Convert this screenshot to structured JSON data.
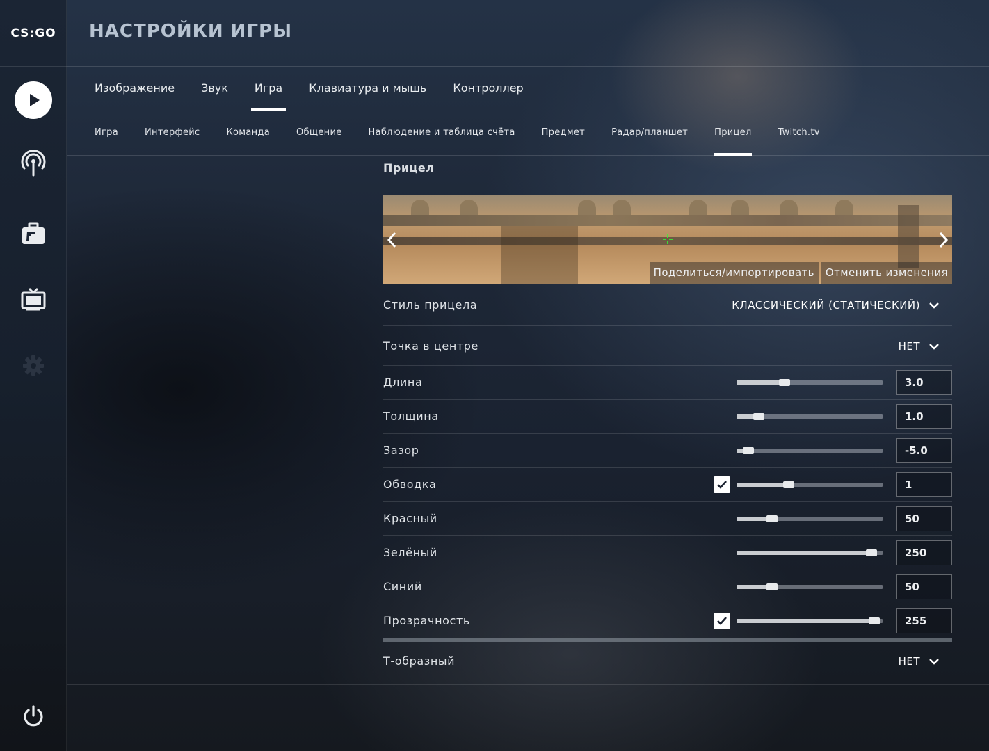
{
  "app": {
    "logo_text": "CS:GO"
  },
  "header": {
    "title": "НАСТРОЙКИ ИГРЫ"
  },
  "sidebar": {
    "items": [
      {
        "icon": "play-icon"
      },
      {
        "icon": "broadcast-icon"
      },
      {
        "icon": "inventory-icon"
      },
      {
        "icon": "tv-icon"
      },
      {
        "icon": "gear-icon"
      },
      {
        "icon": "power-icon"
      }
    ]
  },
  "main_tabs": [
    {
      "label": "Изображение",
      "active": false
    },
    {
      "label": "Звук",
      "active": false
    },
    {
      "label": "Игра",
      "active": true
    },
    {
      "label": "Клавиатура и мышь",
      "active": false
    },
    {
      "label": "Контроллер",
      "active": false
    }
  ],
  "sub_tabs": [
    {
      "label": "Игра",
      "active": false
    },
    {
      "label": "Интерфейс",
      "active": false
    },
    {
      "label": "Команда",
      "active": false
    },
    {
      "label": "Общение",
      "active": false
    },
    {
      "label": "Наблюдение и таблица счёта",
      "active": false
    },
    {
      "label": "Предмет",
      "active": false
    },
    {
      "label": "Радар/планшет",
      "active": false
    },
    {
      "label": "Прицел",
      "active": true
    },
    {
      "label": "Twitch.tv",
      "active": false
    }
  ],
  "section": {
    "title": "Прицел",
    "preview": {
      "share_label": "Поделиться/импортировать",
      "revert_label": "Отменить изменения",
      "crosshair_color": "#32fa32"
    },
    "dropdowns": {
      "style": {
        "label": "Стиль прицела",
        "value": "КЛАССИЧЕСКИЙ (СТАТИЧЕСКИЙ)"
      },
      "center_dot": {
        "label": "Точка в центре",
        "value": "НЕТ"
      },
      "t_style": {
        "label": "Т-образный",
        "value": "НЕТ"
      }
    },
    "sliders": [
      {
        "label": "Длина",
        "value": "3.0",
        "fraction": 0.31,
        "checkbox": false
      },
      {
        "label": "Толщина",
        "value": "1.0",
        "fraction": 0.12,
        "checkbox": false
      },
      {
        "label": "Зазор",
        "value": "-5.0",
        "fraction": 0.04,
        "checkbox": false
      },
      {
        "label": "Обводка",
        "value": "1",
        "fraction": 0.34,
        "checkbox": true,
        "checked": true
      },
      {
        "label": "Красный",
        "value": "50",
        "fraction": 0.22,
        "checkbox": false
      },
      {
        "label": "Зелёный",
        "value": "250",
        "fraction": 0.96,
        "checkbox": false
      },
      {
        "label": "Синий",
        "value": "50",
        "fraction": 0.22,
        "checkbox": false
      },
      {
        "label": "Прозрачность",
        "value": "255",
        "fraction": 0.98,
        "checkbox": true,
        "checked": true
      }
    ]
  }
}
